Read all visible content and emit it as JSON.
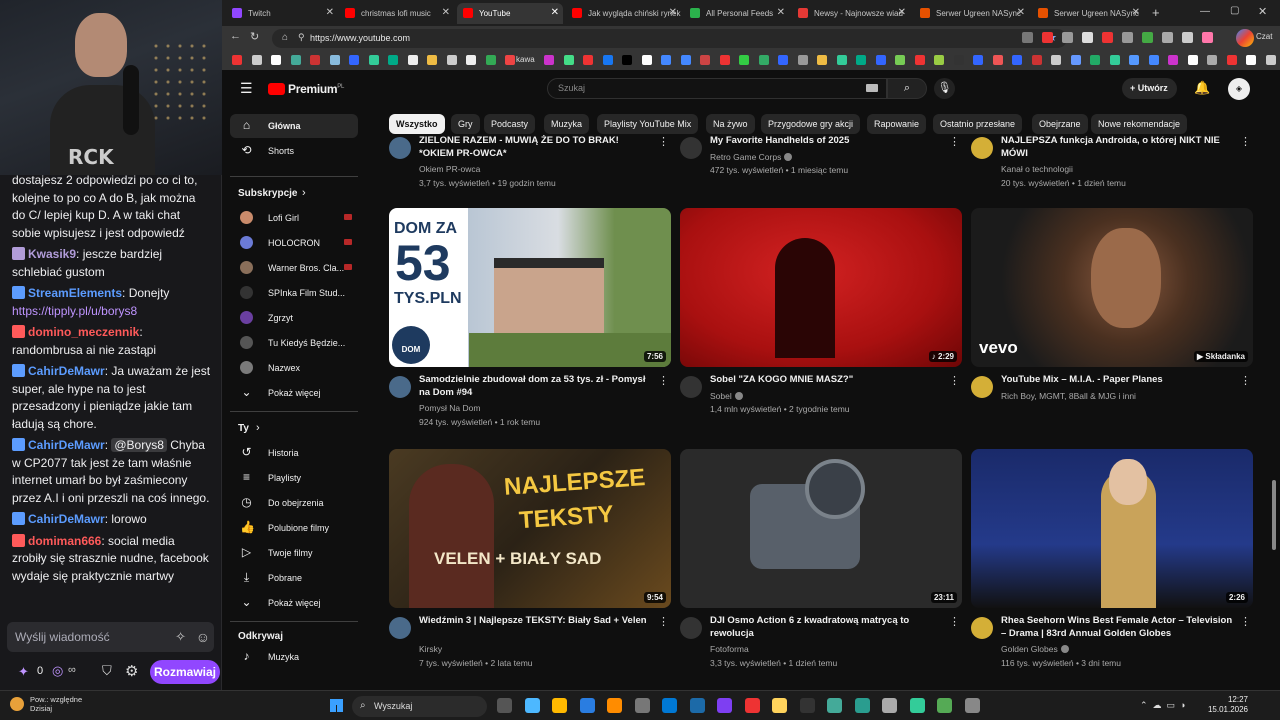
{
  "chat": {
    "messages": [
      {
        "user": "",
        "color": "#efeff1",
        "text": "dostajesz 2 odpowiedzi po co ci to, kolejne to po co A do B, jak można do C/ lepiej kup D. A w taki chat sobie wpisujesz i jest odpowiedź"
      },
      {
        "user": "Kwasik9",
        "color": "#b19cd9",
        "text": "jescze bardziej schlebiać gustom"
      },
      {
        "user": "StreamElements",
        "color": "#5c9cff",
        "text": "Donejty",
        "link": "https://tipply.pl/u/borys8"
      },
      {
        "user": "domino_meczennik",
        "color": "#ff5a5a",
        "text": "randombrusa ai nie zastąpi"
      },
      {
        "user": "CahirDeMawr",
        "color": "#5c9cff",
        "text": "Ja uważam że jest super, ale hype na to jest przesadzony i pieniądze jakie tam ładują są chore."
      },
      {
        "user": "CahirDeMawr",
        "color": "#5c9cff",
        "mention": "@Borys8",
        "text": "Chyba w CP2077 tak jest że tam właśnie internet umarł bo był zaśmiecony przez A.I i oni przeszli na coś innego."
      },
      {
        "user": "CahirDeMawr",
        "color": "#5c9cff",
        "text": "lorowo"
      },
      {
        "user": "domiman666",
        "color": "#ff5a5a",
        "text": "social media zrobiły się strasznie nudne, facebook wydaje się praktycznie martwy"
      }
    ],
    "input_placeholder": "Wyślij wiadomość",
    "points": "0",
    "send_label": "Rozmawiaj",
    "cam_shirt_text": "RCK"
  },
  "browser": {
    "tabs": [
      {
        "label": "Twitch",
        "color": "#9147ff"
      },
      {
        "label": "christmas lofi music",
        "color": "#f00"
      },
      {
        "label": "YouTube",
        "color": "#f00",
        "active": true
      },
      {
        "label": "Jak wygląda chiński rynek",
        "color": "#f00"
      },
      {
        "label": "All Personal Feeds",
        "color": "#2bb24c"
      },
      {
        "label": "Newsy - Najnowsze wiad",
        "color": "#e53935"
      },
      {
        "label": "Serwer Ugreen NASync",
        "color": "#e65100"
      },
      {
        "label": "Serwer Ugreen NASync",
        "color": "#e65100"
      }
    ],
    "url": "https://www.youtube.com",
    "bookmark_label": "kawa",
    "chat_button": "Czat"
  },
  "youtube": {
    "logo": "Premium",
    "logo_region": "PL",
    "search_placeholder": "Szukaj",
    "create_label": "Utwórz",
    "sidebar": {
      "main": [
        {
          "label": "Główna",
          "icon": "⌂",
          "active": true
        },
        {
          "label": "Shorts",
          "icon": "⟲"
        }
      ],
      "subs_header": "Subskrypcje",
      "subs": [
        {
          "label": "Lofi Girl",
          "color": "#c98b6b",
          "live": true
        },
        {
          "label": "HOLOCRON",
          "color": "#6b7bd6",
          "live": true
        },
        {
          "label": "Warner Bros. Cla...",
          "color": "#8a6f5a",
          "live": true
        },
        {
          "label": "SPInka Film Stud...",
          "color": "#333",
          "live": false
        },
        {
          "label": "Zgrzyt",
          "color": "#6a3fa0",
          "live": false
        },
        {
          "label": "Tu Kiedyś Będzie...",
          "color": "#555",
          "live": false
        },
        {
          "label": "Nazwex",
          "color": "#7a7a7a",
          "live": false
        }
      ],
      "show_more": "Pokaż więcej",
      "you_header": "Ty",
      "you": [
        {
          "label": "Historia",
          "icon": "↺"
        },
        {
          "label": "Playlisty",
          "icon": "≡"
        },
        {
          "label": "Do obejrzenia",
          "icon": "◷"
        },
        {
          "label": "Polubione filmy",
          "icon": "👍"
        },
        {
          "label": "Twoje filmy",
          "icon": "▷"
        },
        {
          "label": "Pobrane",
          "icon": "⤓"
        }
      ],
      "show_more2": "Pokaż więcej",
      "explore_header": "Odkrywaj",
      "explore": [
        {
          "label": "Muzyka",
          "icon": "♪"
        }
      ]
    },
    "chips": [
      "Wszystko",
      "Gry",
      "Podcasty",
      "Muzyka",
      "Playlisty YouTube Mix",
      "Na żywo",
      "Przygodowe gry akcji",
      "Rapowanie",
      "Ostatnio przesłane",
      "Obejrzane",
      "Nowe rekomendacje"
    ],
    "top_row": [
      {
        "title": "ZIELONE RAZEM - MUWIĄ ŻE DO TO BRAK! *OKIEM PR-OWCA*",
        "channel": "Okiem PR-owca",
        "meta": "3,7 tys. wyświetleń • 19 godzin temu",
        "verified": false
      },
      {
        "title": "My Favorite Handhelds of 2025",
        "channel": "Retro Game Corps",
        "meta": "472 tys. wyświetleń • 1 miesiąc temu",
        "verified": true
      },
      {
        "title": "NAJLEPSZA funkcja Androida, o której NIKT NIE MÓWI",
        "channel": "Kanał o technologii",
        "meta": "20 tys. wyświetleń • 1 dzień temu",
        "verified": false
      }
    ],
    "row1": [
      {
        "title": "Samodzielnie zbudował dom za 53 tys. zł - Pomysł na Dom #94",
        "channel": "Pomysł Na Dom",
        "meta": "924 tys. wyświetleń • 1 rok temu",
        "duration": "7:56",
        "verified": false,
        "overlay": [
          "DOM ZA",
          "53",
          "TYS.PLN"
        ],
        "badge": "DOM"
      },
      {
        "title": "Sobel \"ZA KOGO MNIE MASZ?\"",
        "channel": "Sobel",
        "meta": "1,4 mln wyświetleń • 2 tygodnie temu",
        "duration": "♪ 2:29",
        "verified": true
      },
      {
        "title": "YouTube Mix – M.I.A. - Paper Planes",
        "channel": "Rich Boy, MGMT, 8Ball & MJG i inni",
        "meta": "",
        "duration": "▶ Składanka",
        "verified": false,
        "overlay": [
          "vevo"
        ]
      }
    ],
    "row2": [
      {
        "title": "Wiedźmin 3 | Najlepsze TEKSTY: Biały Sad + Velen",
        "channel": "Kirsky",
        "meta": "7 tys. wyświetleń • 2 lata temu",
        "duration": "9:54",
        "verified": false,
        "overlay": [
          "NAJLEPSZE",
          "TEKSTY",
          "VELEN + BIAŁY SAD"
        ]
      },
      {
        "title": "DJI Osmo Action 6 z kwadratową matrycą to rewolucja",
        "channel": "Fotoforma",
        "meta": "3,3 tys. wyświetleń • 1 dzień temu",
        "duration": "23:11",
        "verified": false
      },
      {
        "title": "Rhea Seehorn Wins Best Female Actor – Television – Drama | 83rd Annual Golden Globes",
        "channel": "Golden Globes",
        "meta": "116 tys. wyświetleń • 3 dni temu",
        "duration": "2:26",
        "verified": true
      }
    ]
  },
  "taskbar": {
    "weather_line1": "Pow.: względne",
    "weather_line2": "Dzisiaj",
    "search": "Wyszukaj",
    "time": "12:27",
    "date": "15.01.2026"
  }
}
